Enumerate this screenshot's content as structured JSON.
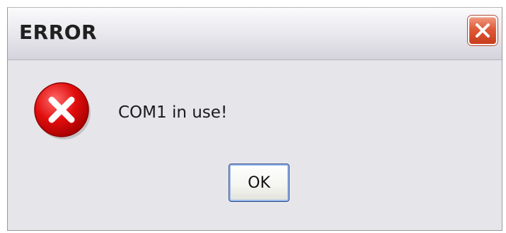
{
  "dialog": {
    "title": "ERROR",
    "message": "COM1 in use!",
    "ok_label": "OK",
    "icons": {
      "close": "close-icon",
      "error": "error-icon"
    }
  },
  "colors": {
    "close_button": "#df5a38",
    "error_icon": "#e10d0d",
    "ok_border": "#25407e"
  }
}
